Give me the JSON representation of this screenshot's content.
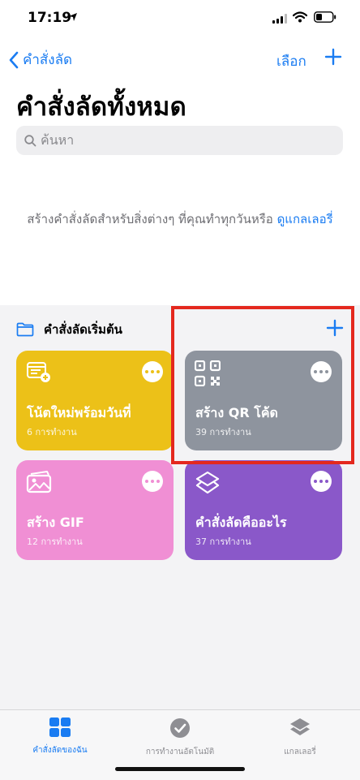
{
  "status": {
    "time": "17:19"
  },
  "nav": {
    "back_label": "คำสั่งลัด",
    "select_label": "เลือก"
  },
  "page": {
    "title": "คำสั่งลัดทั้งหมด"
  },
  "search": {
    "placeholder": "ค้นหา"
  },
  "promo": {
    "text": "สร้างคำสั่งลัดสำหรับสิ่งต่างๆ ที่คุณทำทุกวันหรือ",
    "link": "ดูแกลเลอรี่"
  },
  "folder": {
    "title": "คำสั่งลัดเริ่มต้น"
  },
  "cards": [
    {
      "title": "โน้ตใหม่พร้อมวันที่",
      "subtitle": "6 การทำงาน",
      "color": "#ecc118",
      "icon": "note-add-icon"
    },
    {
      "title": "สร้าง QR โค้ด",
      "subtitle": "39 การทำงาน",
      "color": "#8e949e",
      "icon": "qr-code-icon"
    },
    {
      "title": "สร้าง GIF",
      "subtitle": "12 การทำงาน",
      "color": "#f08fd4",
      "icon": "photos-icon"
    },
    {
      "title": "คำสั่งลัดคืออะไร",
      "subtitle": "37 การทำงาน",
      "color": "#8a58c9",
      "icon": "shortcuts-layers-icon"
    }
  ],
  "tabs": [
    {
      "label": "คำสั่งลัดของฉัน",
      "icon": "grid-icon",
      "active": true
    },
    {
      "label": "การทำงานอัตโนมัติ",
      "icon": "automation-clock-icon",
      "active": false
    },
    {
      "label": "แกลเลอรี่",
      "icon": "gallery-layers-icon",
      "active": false
    }
  ],
  "colors": {
    "accent": "#1a7cf2",
    "highlight": "#e4281e"
  }
}
